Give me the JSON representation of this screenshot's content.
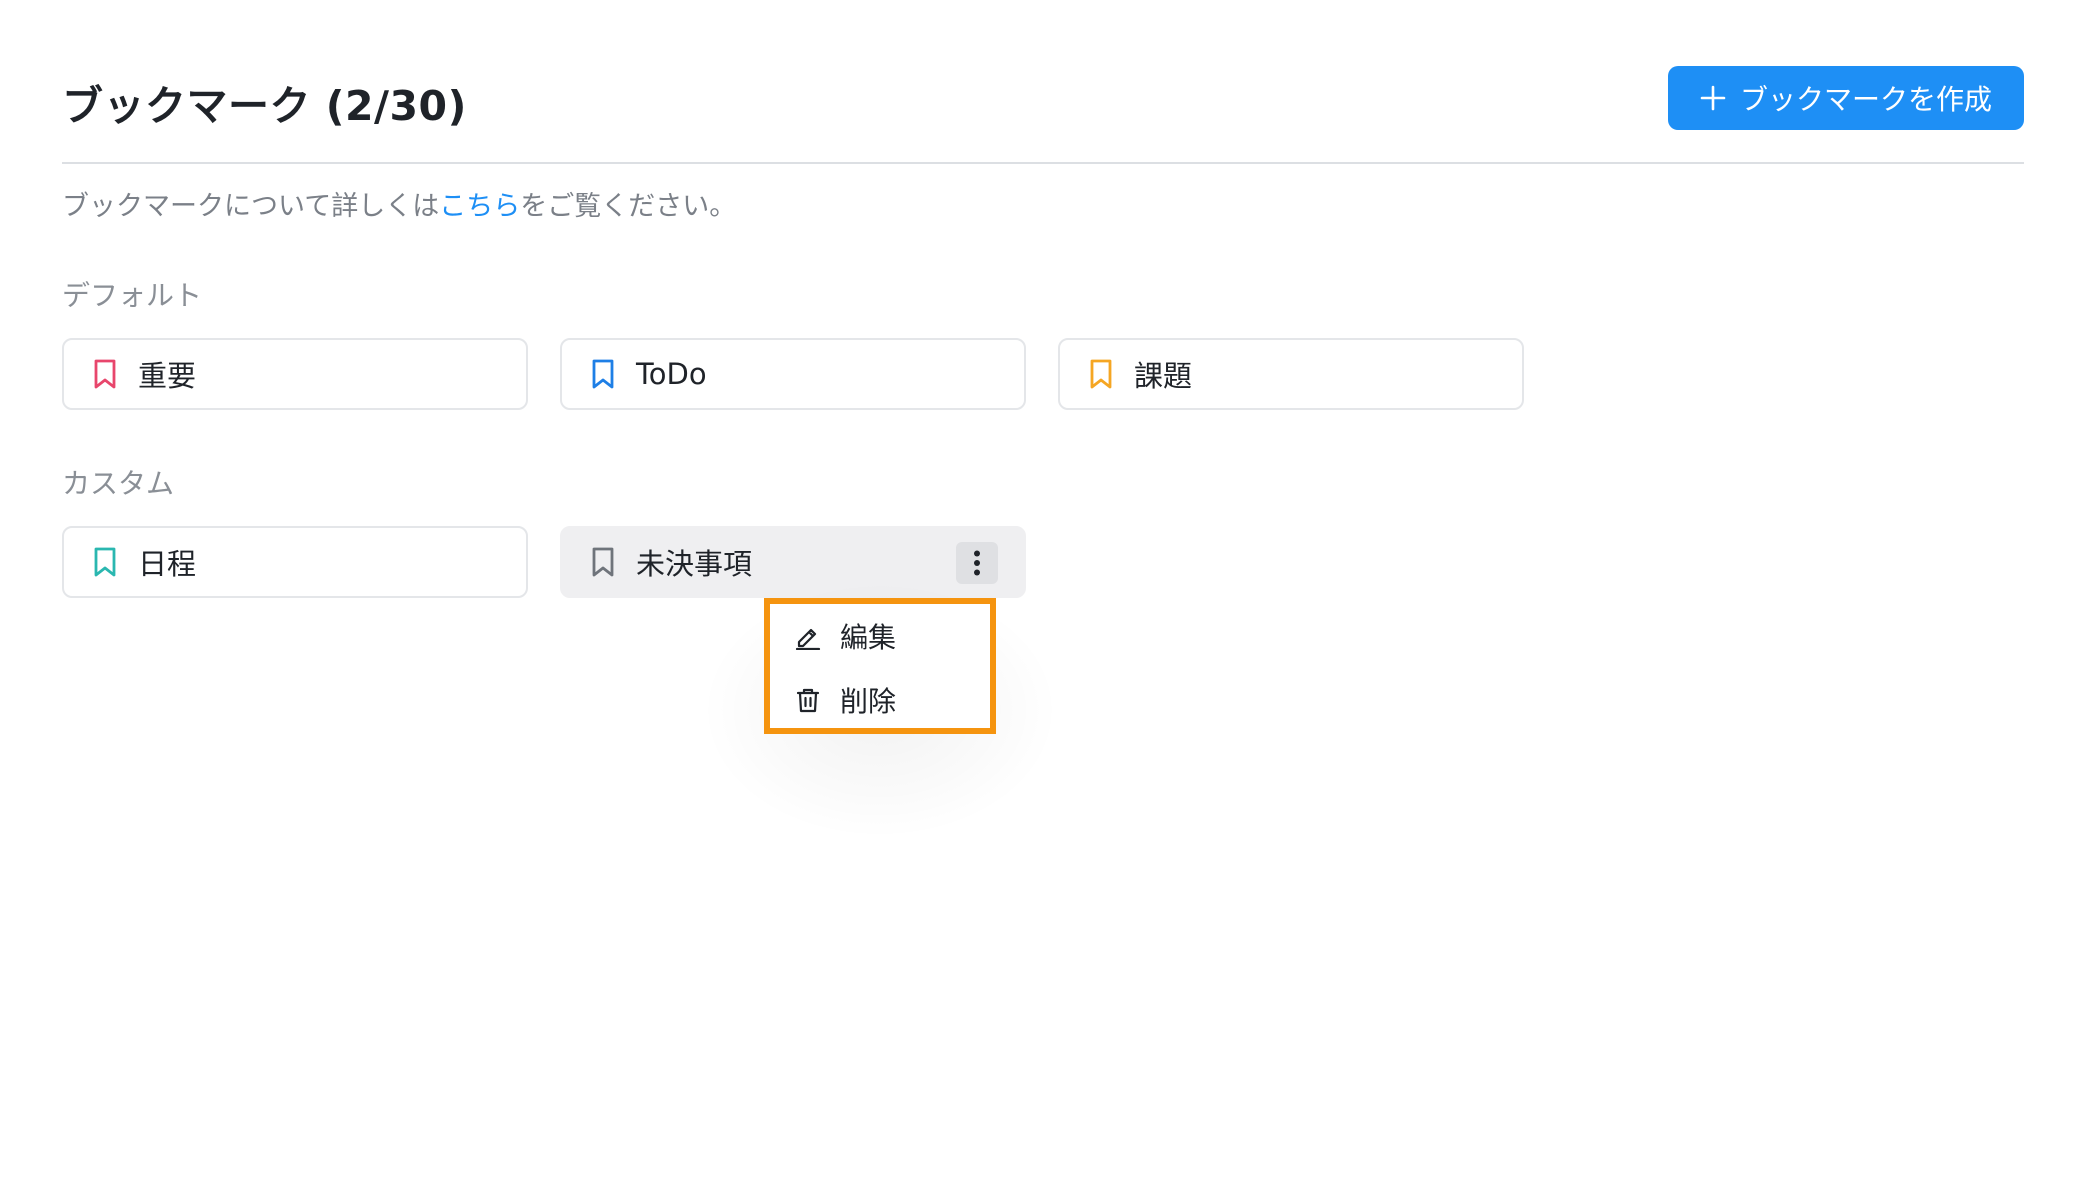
{
  "header": {
    "title": "ブックマーク (2/30)",
    "create_button_label": "ブックマークを作成"
  },
  "info": {
    "prefix": "ブックマークについて詳しくは",
    "link": "こちら",
    "suffix": "をご覧ください。"
  },
  "sections": {
    "default_label": "デフォルト",
    "custom_label": "カスタム"
  },
  "default_bookmarks": [
    {
      "label": "重要",
      "color": "#e8466c"
    },
    {
      "label": "ToDo",
      "color": "#1e7fe6"
    },
    {
      "label": "課題",
      "color": "#f5a623"
    }
  ],
  "custom_bookmarks": [
    {
      "label": "日程",
      "color": "#2ab7b0"
    },
    {
      "label": "未決事項",
      "color": "#6f747b"
    }
  ],
  "menu": {
    "edit_label": "編集",
    "delete_label": "削除"
  },
  "icons": {
    "bookmark": "bookmark-icon",
    "plus": "plus-icon",
    "more": "more-vertical-icon",
    "edit": "pencil-icon",
    "delete": "trash-icon"
  },
  "colors": {
    "accent": "#1e8ff5",
    "highlight_border": "#f5940f"
  }
}
